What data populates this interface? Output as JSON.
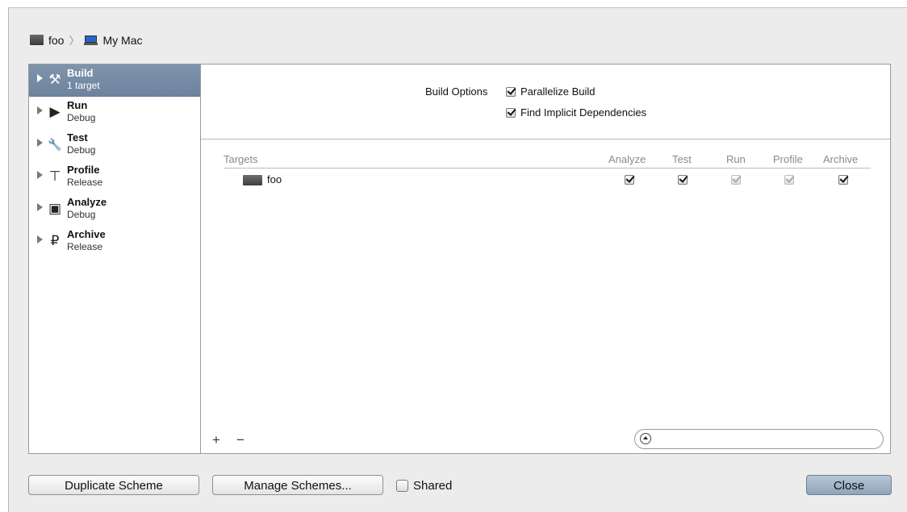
{
  "breadcrumb": {
    "project": "foo",
    "separator": "〉",
    "destination": "My Mac",
    "project_icon": "project-icon",
    "destination_icon": "computer-icon"
  },
  "sidebar": {
    "items": [
      {
        "name": "Build",
        "sub": "1 target",
        "icon": "hammer-icon",
        "glyph": "⚒",
        "selected": true
      },
      {
        "name": "Run",
        "sub": "Debug",
        "icon": "play-icon",
        "glyph": "▶",
        "selected": false
      },
      {
        "name": "Test",
        "sub": "Debug",
        "icon": "wrench-icon",
        "glyph": "🔧",
        "selected": false
      },
      {
        "name": "Profile",
        "sub": "Release",
        "icon": "caliper-icon",
        "glyph": "⊤",
        "selected": false
      },
      {
        "name": "Analyze",
        "sub": "Debug",
        "icon": "analyze-icon",
        "glyph": "▣",
        "selected": false
      },
      {
        "name": "Archive",
        "sub": "Release",
        "icon": "archive-icon",
        "glyph": "₽",
        "selected": false
      }
    ]
  },
  "build_options": {
    "label": "Build Options",
    "parallelize": {
      "label": "Parallelize Build",
      "checked": true
    },
    "implicit": {
      "label": "Find Implicit Dependencies",
      "checked": true
    }
  },
  "targets_table": {
    "headers": {
      "targets": "Targets",
      "analyze": "Analyze",
      "test": "Test",
      "run": "Run",
      "profile": "Profile",
      "archive": "Archive"
    },
    "rows": [
      {
        "name": "foo",
        "analyze": true,
        "test": true,
        "run": "disabled-checked",
        "profile": "disabled-checked",
        "archive": true
      }
    ]
  },
  "footer": {
    "add": "+",
    "remove": "−",
    "filter_placeholder": ""
  },
  "buttons": {
    "duplicate": "Duplicate Scheme",
    "manage": "Manage Schemes...",
    "shared": "Shared",
    "shared_checked": false,
    "close": "Close"
  },
  "colors": {
    "selection": "#7589a2",
    "window_bg": "#ececec",
    "primary_button": "#9fb1c6"
  }
}
